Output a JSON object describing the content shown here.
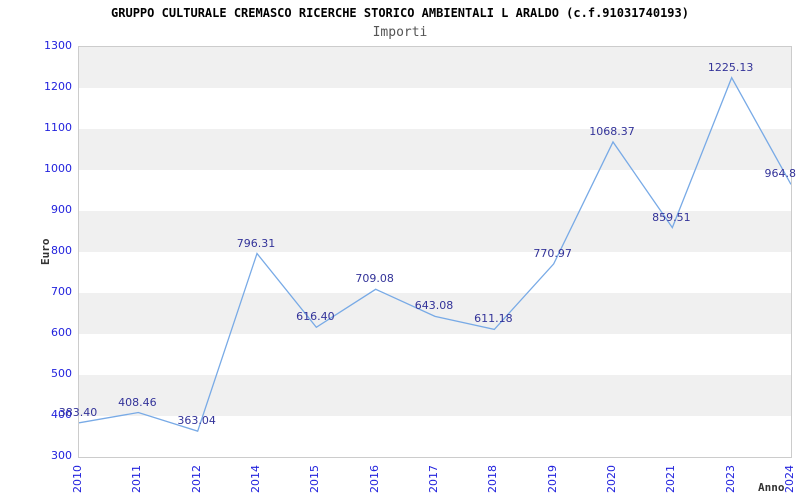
{
  "chart_data": {
    "type": "line",
    "title": "GRUPPO CULTURALE CREMASCO RICERCHE STORICO AMBIENTALI L ARALDO (c.f.91031740193)",
    "subtitle": "Importi",
    "ylabel": "Euro",
    "xlabel": "Anno",
    "categories": [
      "2010",
      "2011",
      "2012",
      "2014",
      "2015",
      "2016",
      "2017",
      "2018",
      "2019",
      "2020",
      "2021",
      "2023",
      "2024"
    ],
    "values": [
      383.4,
      408.46,
      363.04,
      796.31,
      616.4,
      709.08,
      643.08,
      611.18,
      770.97,
      1068.37,
      859.51,
      1225.13,
      964.8
    ],
    "point_labels": [
      "383.40",
      "408.46",
      "363.04",
      "796.31",
      "616.40",
      "709.08",
      "643.08",
      "611.18",
      "770.97",
      "1068.37",
      "859.51",
      "1225.13",
      "964.8"
    ],
    "ylim": [
      300,
      1300
    ],
    "ytick_step": 100,
    "grid": "alternating-horizontal-bands",
    "legend_position": "none",
    "colors": {
      "line": "#78aae6",
      "tick_label": "#2222dd",
      "point_label": "#333399",
      "band": "#f0f0f0",
      "band_alt": "#ffffff",
      "plot_border": "#cccccc",
      "title": "#000000",
      "subtitle": "#555555",
      "axis_title": "#333333"
    }
  }
}
